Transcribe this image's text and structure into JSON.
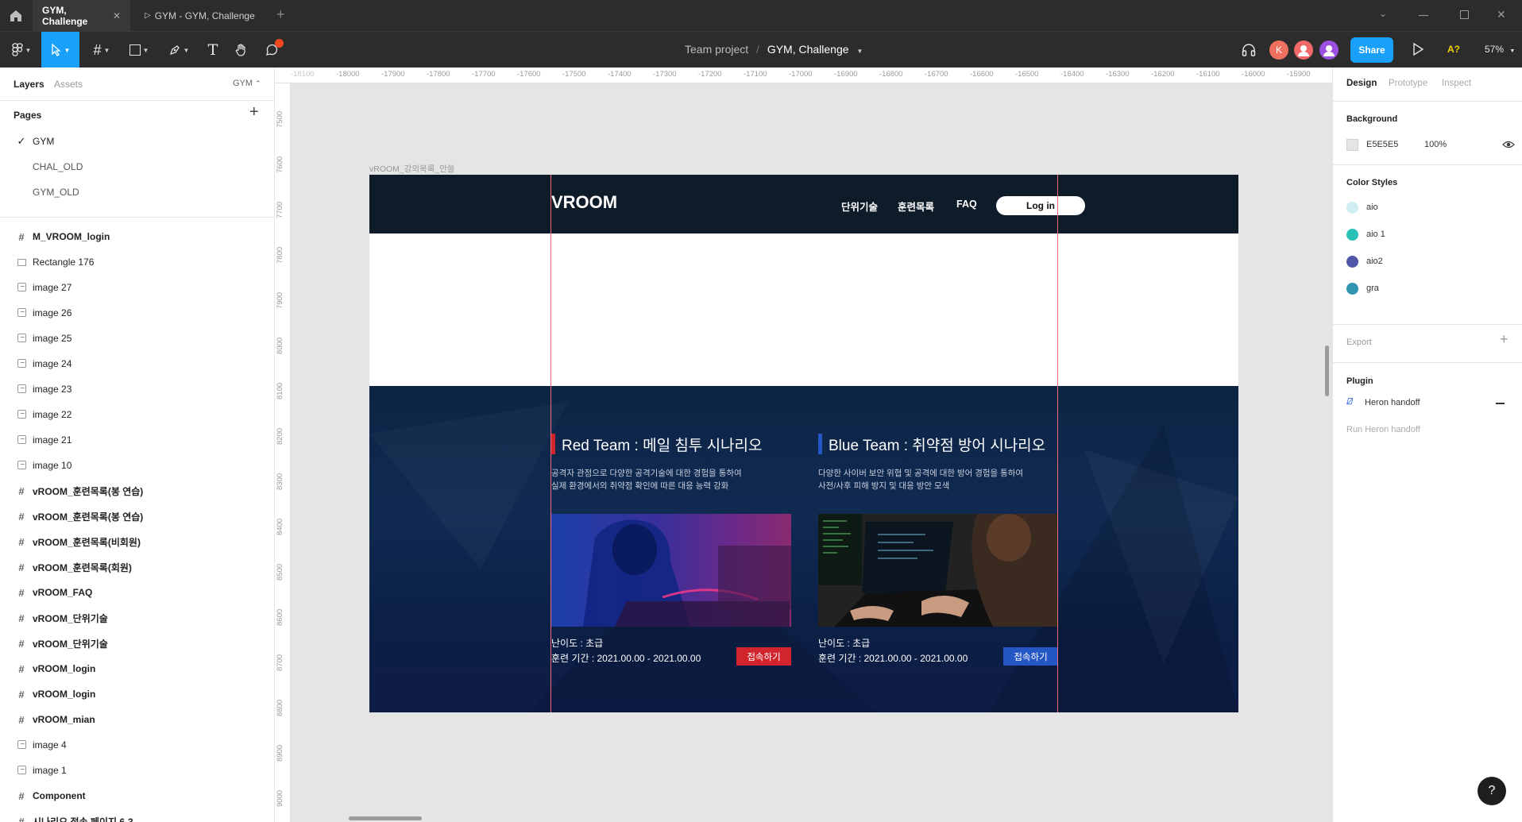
{
  "titlebar": {
    "tabs": [
      {
        "label": "GYM, Challenge",
        "active": true
      },
      {
        "label": "GYM - GYM, Challenge",
        "active": false
      }
    ]
  },
  "toolbar": {
    "breadcrumb_project": "Team project",
    "breadcrumb_sep": "/",
    "file_name": "GYM, Challenge",
    "avatar_k": "K",
    "share_label": "Share",
    "a11y_label": "A?",
    "zoom": "57%"
  },
  "left_panel": {
    "tabs": [
      "Layers",
      "Assets"
    ],
    "page_select": "GYM",
    "pages_title": "Pages",
    "pages": [
      {
        "label": "GYM",
        "checked": true
      },
      {
        "label": "CHAL_OLD",
        "checked": false
      },
      {
        "label": "GYM_OLD",
        "checked": false
      }
    ],
    "layers": [
      {
        "label": "M_VROOM_login",
        "kind": "frame"
      },
      {
        "label": "Rectangle 176",
        "kind": "rect"
      },
      {
        "label": "image 27",
        "kind": "image"
      },
      {
        "label": "image 26",
        "kind": "image"
      },
      {
        "label": "image 25",
        "kind": "image"
      },
      {
        "label": "image 24",
        "kind": "image"
      },
      {
        "label": "image 23",
        "kind": "image"
      },
      {
        "label": "image 22",
        "kind": "image"
      },
      {
        "label": "image 21",
        "kind": "image"
      },
      {
        "label": "image 10",
        "kind": "image"
      },
      {
        "label": "vROOM_훈련목록(봉 연습)",
        "kind": "frame"
      },
      {
        "label": "vROOM_훈련목록(봉 연습)",
        "kind": "frame"
      },
      {
        "label": "vROOM_훈련목록(비회원)",
        "kind": "frame"
      },
      {
        "label": "vROOM_훈련목록(회원)",
        "kind": "frame"
      },
      {
        "label": "vROOM_FAQ",
        "kind": "frame"
      },
      {
        "label": "vROOM_단위기술",
        "kind": "frame"
      },
      {
        "label": "vROOM_단위기술",
        "kind": "frame"
      },
      {
        "label": "vROOM_login",
        "kind": "frame"
      },
      {
        "label": "vROOM_login",
        "kind": "frame"
      },
      {
        "label": "vROOM_mian",
        "kind": "frame"
      },
      {
        "label": "image 4",
        "kind": "image"
      },
      {
        "label": "image 1",
        "kind": "image"
      },
      {
        "label": "Component",
        "kind": "frame"
      },
      {
        "label": "시나리오 접속 페이지 6-3",
        "kind": "frame"
      }
    ]
  },
  "right_panel": {
    "tabs": [
      "Design",
      "Prototype",
      "Inspect"
    ],
    "background_title": "Background",
    "background_hex": "E5E5E5",
    "background_opacity": "100%",
    "color_styles_title": "Color Styles",
    "color_styles": [
      {
        "name": "aio",
        "color": "#cfeff2"
      },
      {
        "name": "aio 1",
        "color": "#27c2b8"
      },
      {
        "name": "aio2",
        "color": "#5056a8"
      },
      {
        "name": "gra",
        "color": "#2f95b0"
      }
    ],
    "export_title": "Export",
    "plugin_title": "Plugin",
    "plugin_name": "Heron handoff",
    "plugin_run": "Run Heron handoff"
  },
  "canvas": {
    "ruler_x": [
      "-18100",
      "-18000",
      "-17900",
      "-17800",
      "-17700",
      "-17600",
      "-17500",
      "-17400",
      "-17300",
      "-17200",
      "-17100",
      "-17000",
      "-16900",
      "-16800",
      "-16700",
      "-16600",
      "-16500",
      "-16400",
      "-16300",
      "-16200",
      "-16100",
      "-16000",
      "-15900"
    ],
    "ruler_y": [
      "7500",
      "7600",
      "7700",
      "7800",
      "7900",
      "8000",
      "8100",
      "8200",
      "8300",
      "8400",
      "8500",
      "8600",
      "8700",
      "8800",
      "8900",
      "9000"
    ],
    "frame_label": "vROOM_강의목록_안쓸"
  },
  "design": {
    "logo": "VROOM",
    "nav": [
      "단위기술",
      "훈련목록",
      "FAQ"
    ],
    "login": "Log in",
    "red": {
      "title": "Red Team : 메일 침투 시나리오",
      "desc1": "공격자 관점으로 다양한 공격기술에 대한 경험을 통하여",
      "desc2": "실제 환경에서의 취약점 확인에 따른 대응 능력 강화",
      "level": "난이도 : 초급",
      "period": "훈련 기간 : 2021.00.00 - 2021.00.00",
      "button": "접속하기",
      "accent": "#d2242d"
    },
    "blue": {
      "title": "Blue Team : 취약점 방어 시나리오",
      "desc1": "다양한 사이버 보안 위협 및 공격에 대한 방어 경험을 통하여",
      "desc2": "사전/사후 피해 방지 및 대응 방안 모색",
      "level": "난이도 : 초급",
      "period": "훈련 기간 : 2021.00.00 - 2021.00.00",
      "button": "접속하기",
      "accent": "#2456c4"
    }
  },
  "help": "?"
}
